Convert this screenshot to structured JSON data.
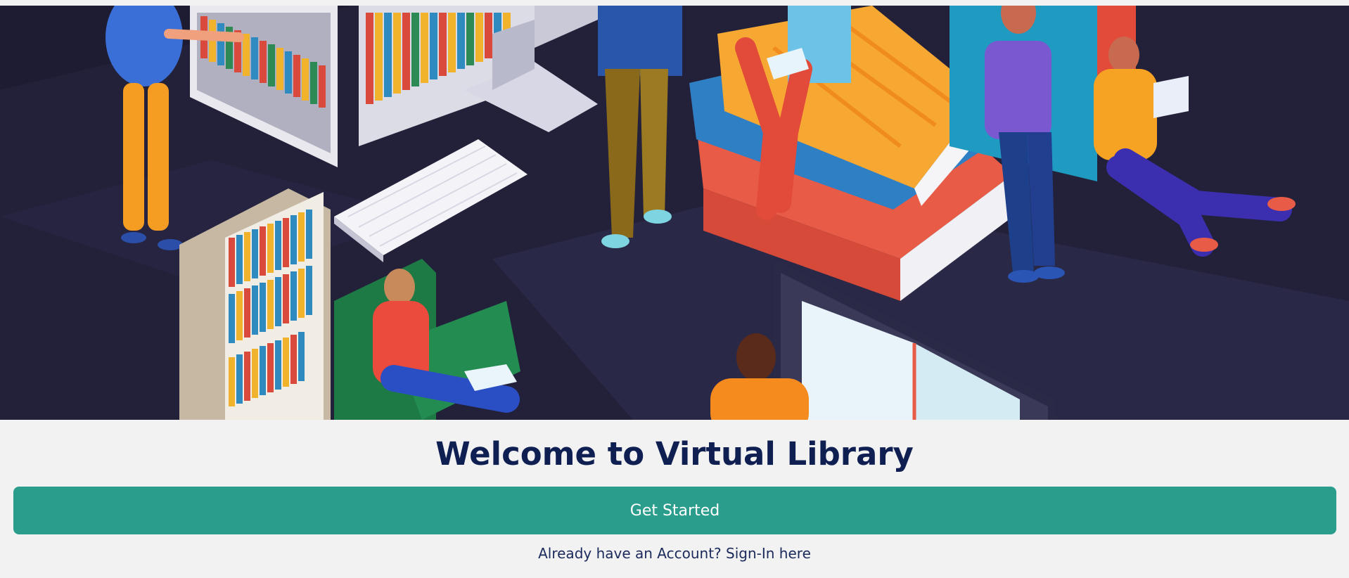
{
  "hero": {
    "image_name": "library-illustration"
  },
  "title": "Welcome to Virtual Library",
  "cta": {
    "label": "Get Started"
  },
  "signin": {
    "prompt": "Already have an Account?",
    "link_label": "Sign-In here"
  },
  "colors": {
    "background": "#f2f2f2",
    "title": "#0f1f52",
    "button": "#2b9d8d",
    "button_text": "#ffffff",
    "link": "#1b2a5a",
    "hero_bg": "#1e1c33"
  }
}
